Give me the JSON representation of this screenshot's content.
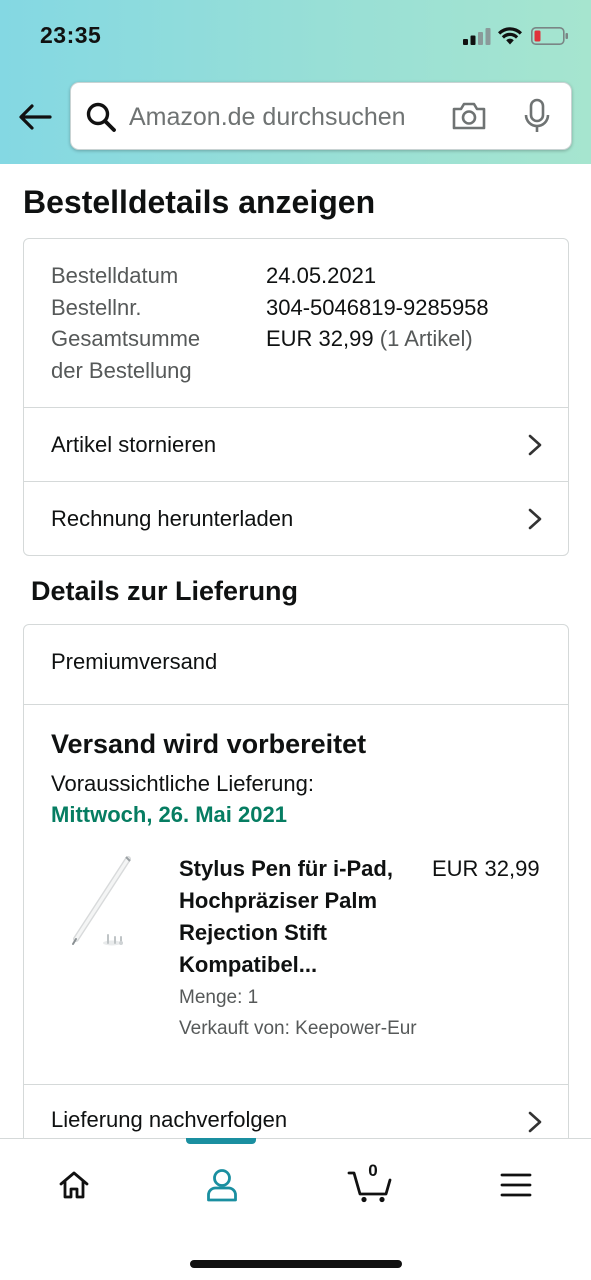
{
  "status_bar": {
    "time": "23:35"
  },
  "search": {
    "placeholder": "Amazon.de durchsuchen"
  },
  "page_title": "Bestelldetails anzeigen",
  "order_summary": {
    "date_label": "Bestelldatum",
    "date_value": "24.05.2021",
    "number_label": "Bestellnr.",
    "number_value": "304-5046819-9285958",
    "total_label_line1": "Gesamtsumme",
    "total_label_line2": "der Bestellung",
    "total_value": "EUR 32,99",
    "total_items": "(1 Artikel)"
  },
  "order_actions": [
    {
      "label": "Artikel stornieren"
    },
    {
      "label": "Rechnung herunterladen"
    }
  ],
  "delivery": {
    "section_title": "Details zur Lieferung",
    "shipping_type": "Premiumversand",
    "status": "Versand wird vorbereitet",
    "expected_label": "Voraussichtliche Lieferung:",
    "expected_date": "Mittwoch, 26. Mai 2021",
    "track_label": "Lieferung nachverfolgen"
  },
  "product": {
    "title": "Stylus Pen für i-Pad, Hochpräziser Palm Rejection Stift Kompatibel...",
    "price": "EUR 32,99",
    "quantity": "Menge: 1",
    "seller": "Verkauft von: Keepower-Eur"
  },
  "bottom_nav": {
    "cart_count": "0",
    "active_item": "account",
    "items": [
      "home-icon",
      "account-icon",
      "cart-icon",
      "menu-icon"
    ]
  },
  "colors": {
    "header_gradient_start": "#84d8e3",
    "header_gradient_end": "#a6e5cf",
    "delivery_date_green": "#067d62",
    "nav_active_teal": "#1a8fa0",
    "battery_low_red": "#e0323a"
  }
}
